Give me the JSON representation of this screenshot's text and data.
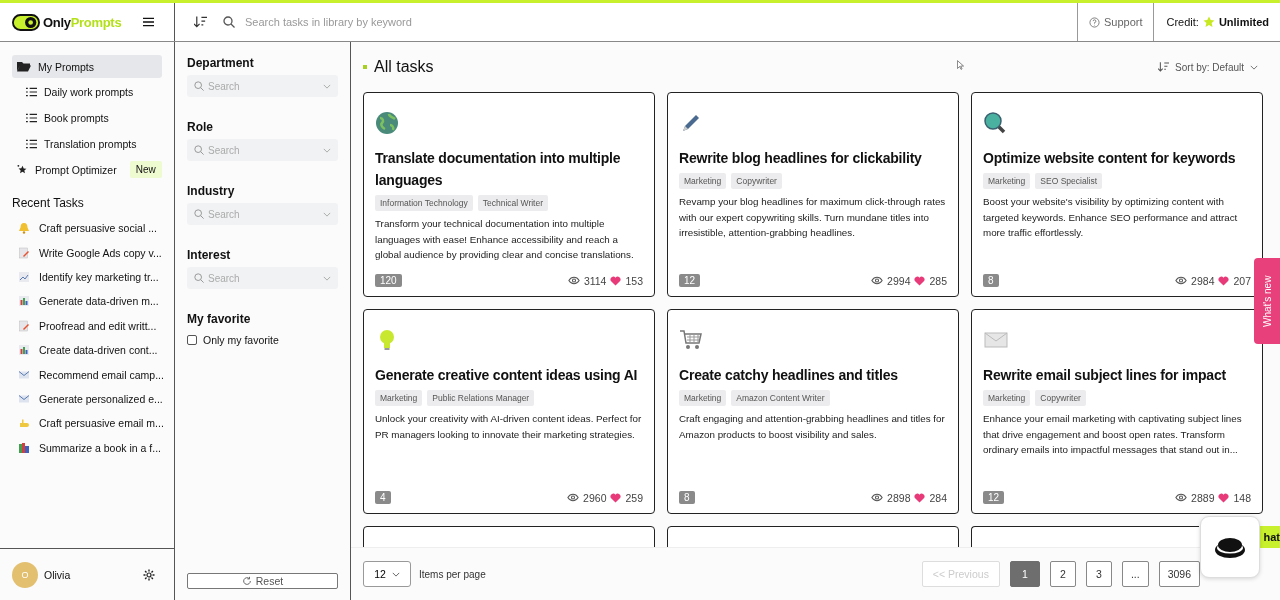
{
  "brand": {
    "first": "Only",
    "second": "Prompts"
  },
  "search": {
    "placeholder": "Search tasks in library by keyword"
  },
  "support": "Support",
  "credit": {
    "label": "Credit:",
    "value": "Unlimited"
  },
  "sidebar": {
    "items": [
      {
        "label": "My Prompts",
        "selected": true,
        "kind": "folder"
      },
      {
        "label": "Daily work prompts",
        "selected": false,
        "kind": "list"
      },
      {
        "label": "Book prompts",
        "selected": false,
        "kind": "list"
      },
      {
        "label": "Translation prompts",
        "selected": false,
        "kind": "list"
      },
      {
        "label": "Prompt Optimizer",
        "selected": false,
        "kind": "star",
        "badge": "New"
      }
    ],
    "recent_title": "Recent Tasks",
    "recent": [
      "Craft persuasive social ...",
      "Write Google Ads copy v...",
      "Identify key marketing tr...",
      "Generate data-driven m...",
      "Proofread and edit writt...",
      "Create data-driven cont...",
      "Recommend email camp...",
      "Generate personalized e...",
      "Craft persuasive email m...",
      "Summarize a book in a f..."
    ],
    "user": {
      "initial": "O",
      "name": "Olivia"
    }
  },
  "filters": {
    "groups": [
      {
        "label": "Department",
        "placeholder": "Search"
      },
      {
        "label": "Role",
        "placeholder": "Search"
      },
      {
        "label": "Industry",
        "placeholder": "Search"
      },
      {
        "label": "Interest",
        "placeholder": "Search"
      }
    ],
    "favorite_title": "My favorite",
    "favorite_option": {
      "label": "Only my favorite",
      "checked": false
    },
    "reset": "Reset"
  },
  "heading": "All tasks",
  "sort": "Sort by: Default",
  "cards": [
    {
      "kind": "full",
      "title": "Translate documentation into multiple languages",
      "tags": [
        "Information Technology",
        "Technical Writer"
      ],
      "description": "Transform your technical documentation into multiple languages with ease! Enhance accessibility and reach a global audience by providing clear and concise translations.",
      "count": "120",
      "views": "3114",
      "likes": "153"
    },
    {
      "kind": "full",
      "title": "Rewrite blog headlines for clickability",
      "tags": [
        "Marketing",
        "Copywriter"
      ],
      "description": "Revamp your blog headlines for maximum click-through rates with our expert copywriting skills. Turn mundane titles into irresistible, attention-grabbing headlines.",
      "count": "12",
      "views": "2994",
      "likes": "285"
    },
    {
      "kind": "full",
      "title": "Optimize website content for keywords",
      "tags": [
        "Marketing",
        "SEO Specialist"
      ],
      "description": "Boost your website's visibility by optimizing content with targeted keywords. Enhance SEO performance and attract more traffic effortlessly.",
      "count": "8",
      "views": "2984",
      "likes": "207"
    },
    {
      "kind": "full",
      "title": "Generate creative content ideas using AI",
      "tags": [
        "Marketing",
        "Public Relations Manager"
      ],
      "description": "Unlock your creativity with AI-driven content ideas. Perfect for PR managers looking to innovate their marketing strategies.",
      "count": "4",
      "views": "2960",
      "likes": "259"
    },
    {
      "kind": "full",
      "title": "Create catchy headlines and titles",
      "tags": [
        "Marketing",
        "Amazon Content Writer"
      ],
      "description": "Craft engaging and attention-grabbing headlines and titles for Amazon products to boost visibility and sales.",
      "count": "8",
      "views": "2898",
      "likes": "284"
    },
    {
      "kind": "full",
      "title": "Rewrite email subject lines for impact",
      "tags": [
        "Marketing",
        "Copywriter"
      ],
      "description": "Enhance your email marketing with captivating subject lines that drive engagement and boost open rates. Transform ordinary emails into impactful messages that stand out in...",
      "count": "12",
      "views": "2889",
      "likes": "148"
    },
    {
      "kind": "partial"
    },
    {
      "kind": "partial"
    },
    {
      "kind": "partial"
    }
  ],
  "pagination": {
    "per_page": "12",
    "per_page_label": "Items per page",
    "previous": {
      "label": "<< Previous",
      "disabled": true
    },
    "pages": [
      {
        "label": "1",
        "selected": true
      },
      {
        "label": "2",
        "selected": false
      },
      {
        "label": "3",
        "selected": false
      },
      {
        "label": "...",
        "selected": false
      },
      {
        "label": "3096",
        "selected": false
      }
    ]
  },
  "whats_new": "What's new",
  "chat_tab": "hat"
}
